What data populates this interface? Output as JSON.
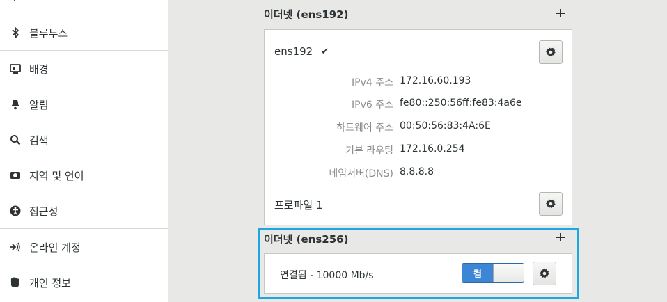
{
  "sidebar": {
    "items": [
      {
        "label": "",
        "icon": "partial-item-icon"
      },
      {
        "label": "블루투스",
        "icon": "bluetooth-icon"
      },
      {
        "label": "배경",
        "icon": "background-icon"
      },
      {
        "label": "알림",
        "icon": "bell-icon"
      },
      {
        "label": "검색",
        "icon": "search-icon"
      },
      {
        "label": "지역 및 언어",
        "icon": "region-icon"
      },
      {
        "label": "접근성",
        "icon": "accessibility-icon"
      },
      {
        "label": "온라인 계정",
        "icon": "online-accounts-icon"
      },
      {
        "label": "개인 정보",
        "icon": "privacy-hand-icon"
      }
    ]
  },
  "ens192": {
    "title": "이더넷 (ens192)",
    "device_name": "ens192",
    "check": "✔",
    "details": [
      {
        "label": "IPv4 주소",
        "value": "172.16.60.193"
      },
      {
        "label": "IPv6 주소",
        "value": "fe80::250:56ff:fe83:4a6e"
      },
      {
        "label": "하드웨어 주소",
        "value": "00:50:56:83:4A:6E"
      },
      {
        "label": "기본 라우팅",
        "value": "172.16.0.254"
      },
      {
        "label": "네임서버(DNS)",
        "value": "8.8.8.8"
      }
    ],
    "profile": "프로파일 1"
  },
  "ens256": {
    "title": "이더넷 (ens256)",
    "status": "연결됨 - 10000 Mb/s",
    "toggle_label": "켬",
    "toggle_state": "on"
  },
  "colors": {
    "accent": "#3d86d6",
    "highlight": "#1ea6e0"
  }
}
